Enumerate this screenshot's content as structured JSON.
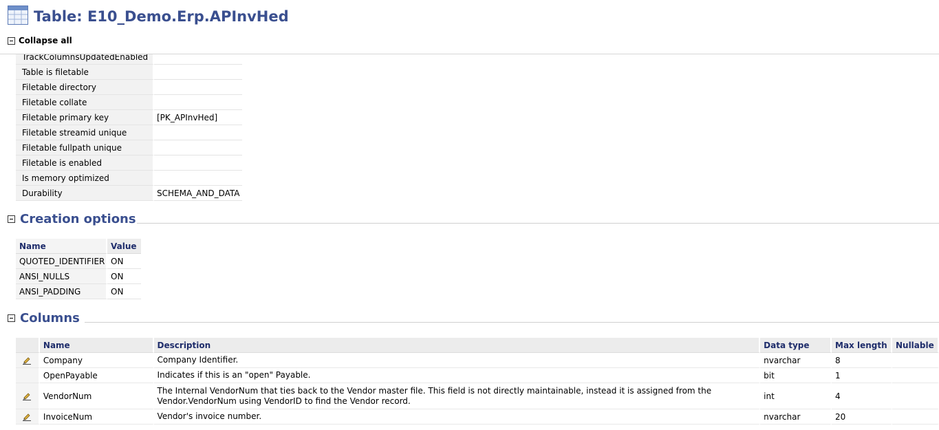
{
  "header": {
    "title": "Table: E10_Demo.Erp.APInvHed",
    "collapse_all": "Collapse all"
  },
  "properties": [
    {
      "name": "TrackColumnsUpdatedEnabled",
      "value": ""
    },
    {
      "name": "Table is filetable",
      "value": ""
    },
    {
      "name": "Filetable directory",
      "value": ""
    },
    {
      "name": "Filetable collate",
      "value": ""
    },
    {
      "name": "Filetable primary key",
      "value": "[PK_APInvHed]"
    },
    {
      "name": "Filetable streamid unique",
      "value": ""
    },
    {
      "name": "Filetable fullpath unique",
      "value": ""
    },
    {
      "name": "Filetable is enabled",
      "value": ""
    },
    {
      "name": "Is memory optimized",
      "value": ""
    },
    {
      "name": "Durability",
      "value": "SCHEMA_AND_DATA"
    }
  ],
  "creation_options": {
    "title": "Creation options",
    "headers": {
      "name": "Name",
      "value": "Value"
    },
    "rows": [
      {
        "name": "QUOTED_IDENTIFIER",
        "value": "ON"
      },
      {
        "name": "ANSI_NULLS",
        "value": "ON"
      },
      {
        "name": "ANSI_PADDING",
        "value": "ON"
      }
    ]
  },
  "columns": {
    "title": "Columns",
    "headers": {
      "name": "Name",
      "description": "Description",
      "data_type": "Data type",
      "max_length": "Max length",
      "nullable": "Nullable"
    },
    "rows": [
      {
        "icon": "edit-icon",
        "name": "Company",
        "description": "Company Identifier.",
        "data_type": "nvarchar",
        "max_length": "8",
        "nullable": ""
      },
      {
        "icon": "",
        "name": "OpenPayable",
        "description": "Indicates if this is an \"open\" Payable.",
        "data_type": "bit",
        "max_length": "1",
        "nullable": ""
      },
      {
        "icon": "edit-icon",
        "name": "VendorNum",
        "description": "The Internal VendorNum that ties back to the Vendor master file. This field is not directly maintainable, instead it is assigned from the Vendor.VendorNum using VendorID to find the Vendor record.",
        "data_type": "int",
        "max_length": "4",
        "nullable": ""
      },
      {
        "icon": "edit-icon",
        "name": "InvoiceNum",
        "description": "Vendor's invoice number.",
        "data_type": "nvarchar",
        "max_length": "20",
        "nullable": ""
      }
    ]
  },
  "colors": {
    "heading": "#3a4f8f",
    "column_header": "#1f2d6b"
  }
}
